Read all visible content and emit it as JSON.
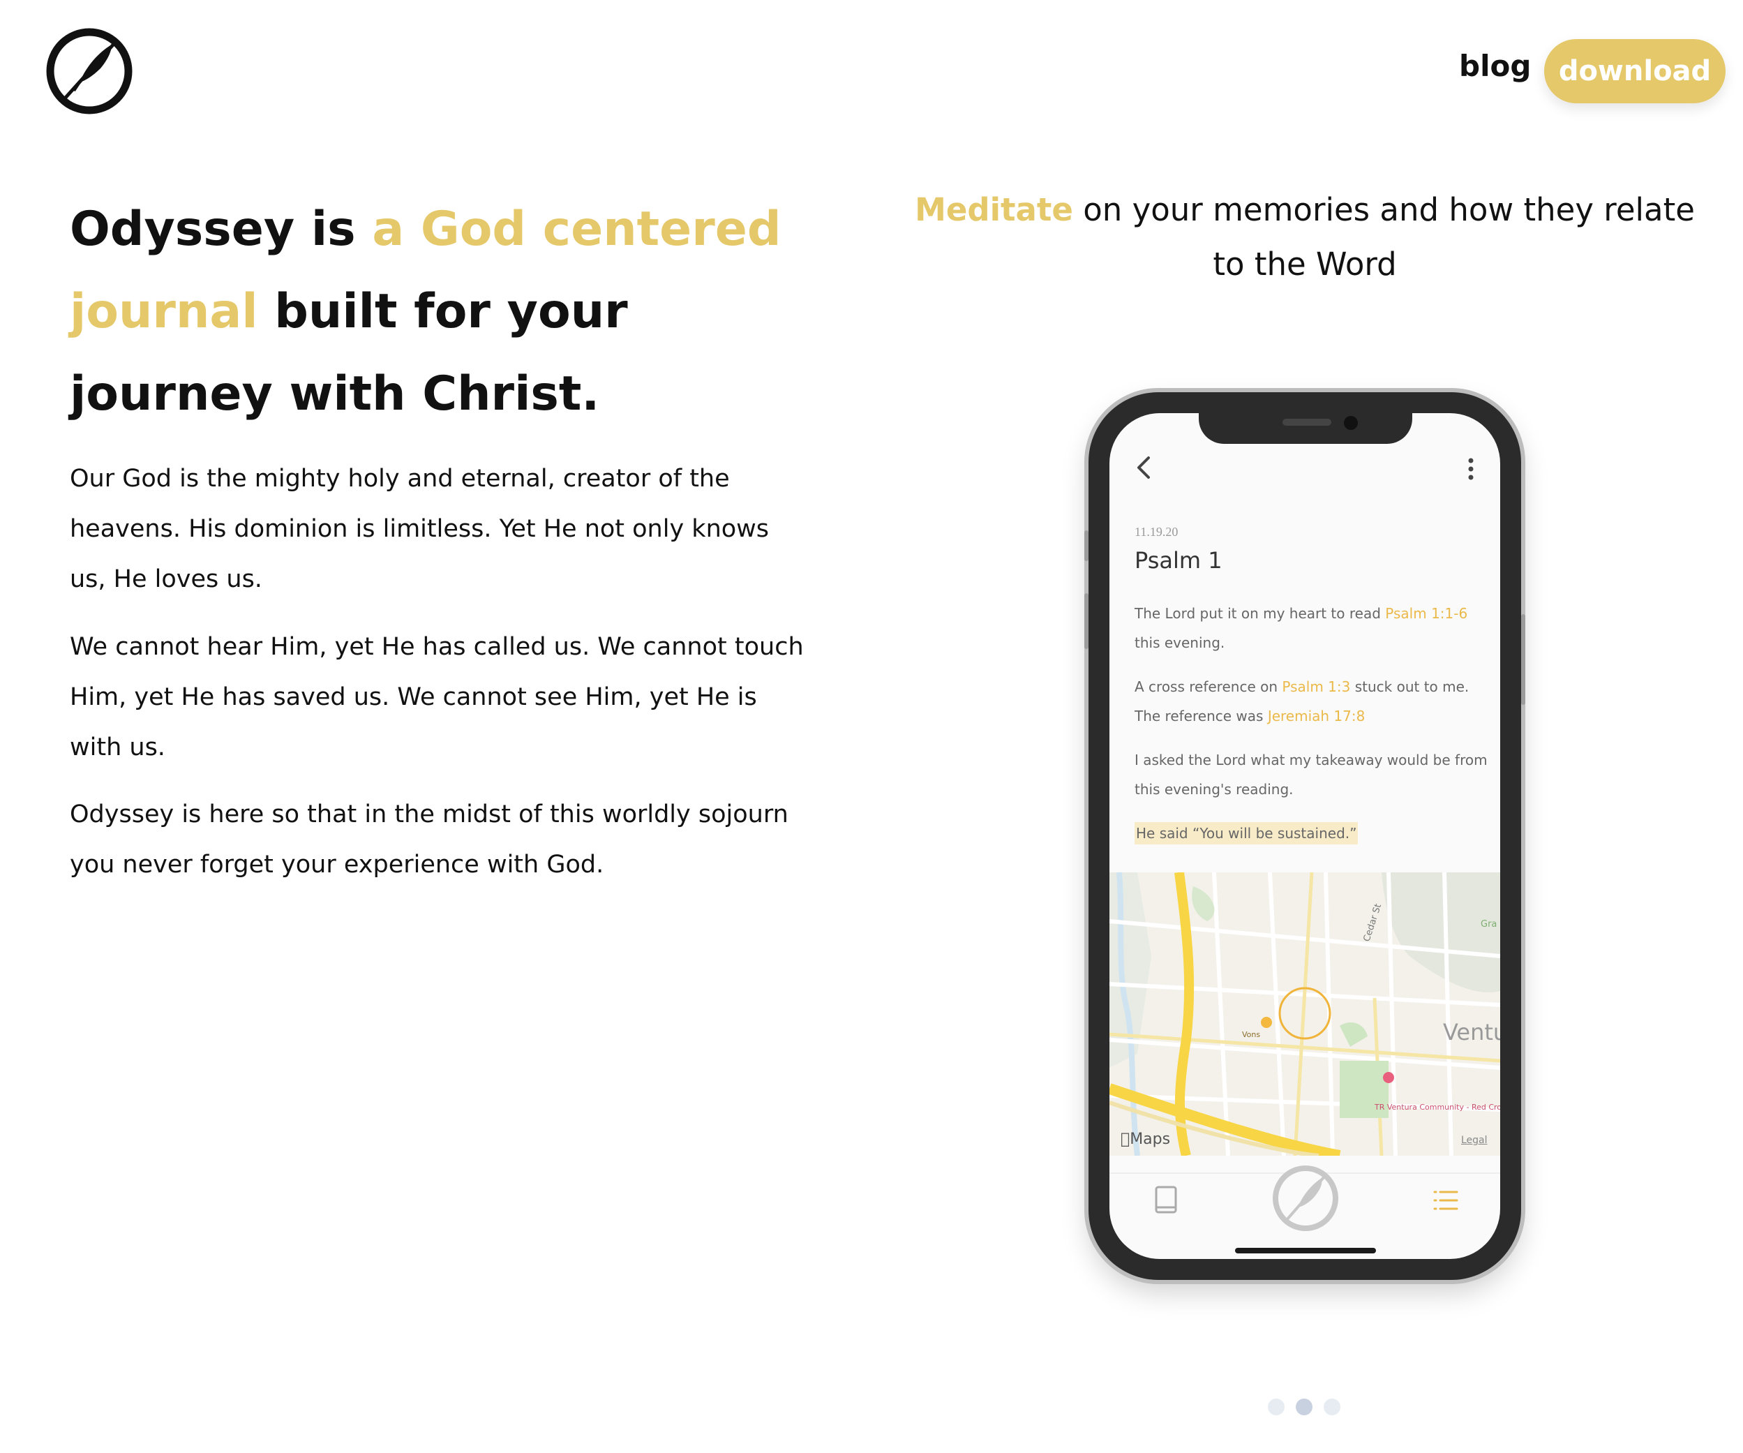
{
  "header": {
    "logo_name": "odyssey-feather-logo",
    "nav_blog": "blog",
    "nav_download": "download"
  },
  "hero": {
    "part1": "Odyssey is ",
    "accent": "a God centered journal",
    "part2": " built for your journey with Christ."
  },
  "paragraphs": [
    "Our God is the mighty holy and eternal, creator of the heavens. His dominion is limitless. Yet He not only knows us, He loves us.",
    "We cannot hear Him, yet He has called us. We cannot touch Him, yet He has saved us. We cannot see Him, yet He is with us.",
    "Odyssey is here so that in the midst of this worldly sojourn you never forget your experience with God."
  ],
  "caption": {
    "accent": "Meditate",
    "rest": " on your memories and how they relate to the Word"
  },
  "phone": {
    "entry": {
      "date": "11.19.20",
      "title": "Psalm 1",
      "p1_before": "The Lord put it on my heart to read ",
      "p1_ref": "Psalm 1:1-6",
      "p1_after": " this evening.",
      "p2_before": "A cross reference on ",
      "p2_ref1": "Psalm 1:3",
      "p2_mid": " stuck out to me. The reference was ",
      "p2_ref2": "Jeremiah 17:8",
      "p3": "I asked the Lord what my takeaway would be from this evening's reading.",
      "p4": "He said “You will be sustained.”"
    },
    "map": {
      "street": "Cedar St",
      "area": "Ventu",
      "poi_store": "Vons",
      "poi_event": "TR Ventura Community - Red Cross Blood Drive",
      "corner": "Gra",
      "maps_label": "Maps",
      "legal_label": "Legal"
    }
  },
  "carousel": {
    "count": 3,
    "active_index": 1
  },
  "colors": {
    "accent": "#e5c869",
    "reference": "#ebb94a",
    "text": "#111111"
  }
}
